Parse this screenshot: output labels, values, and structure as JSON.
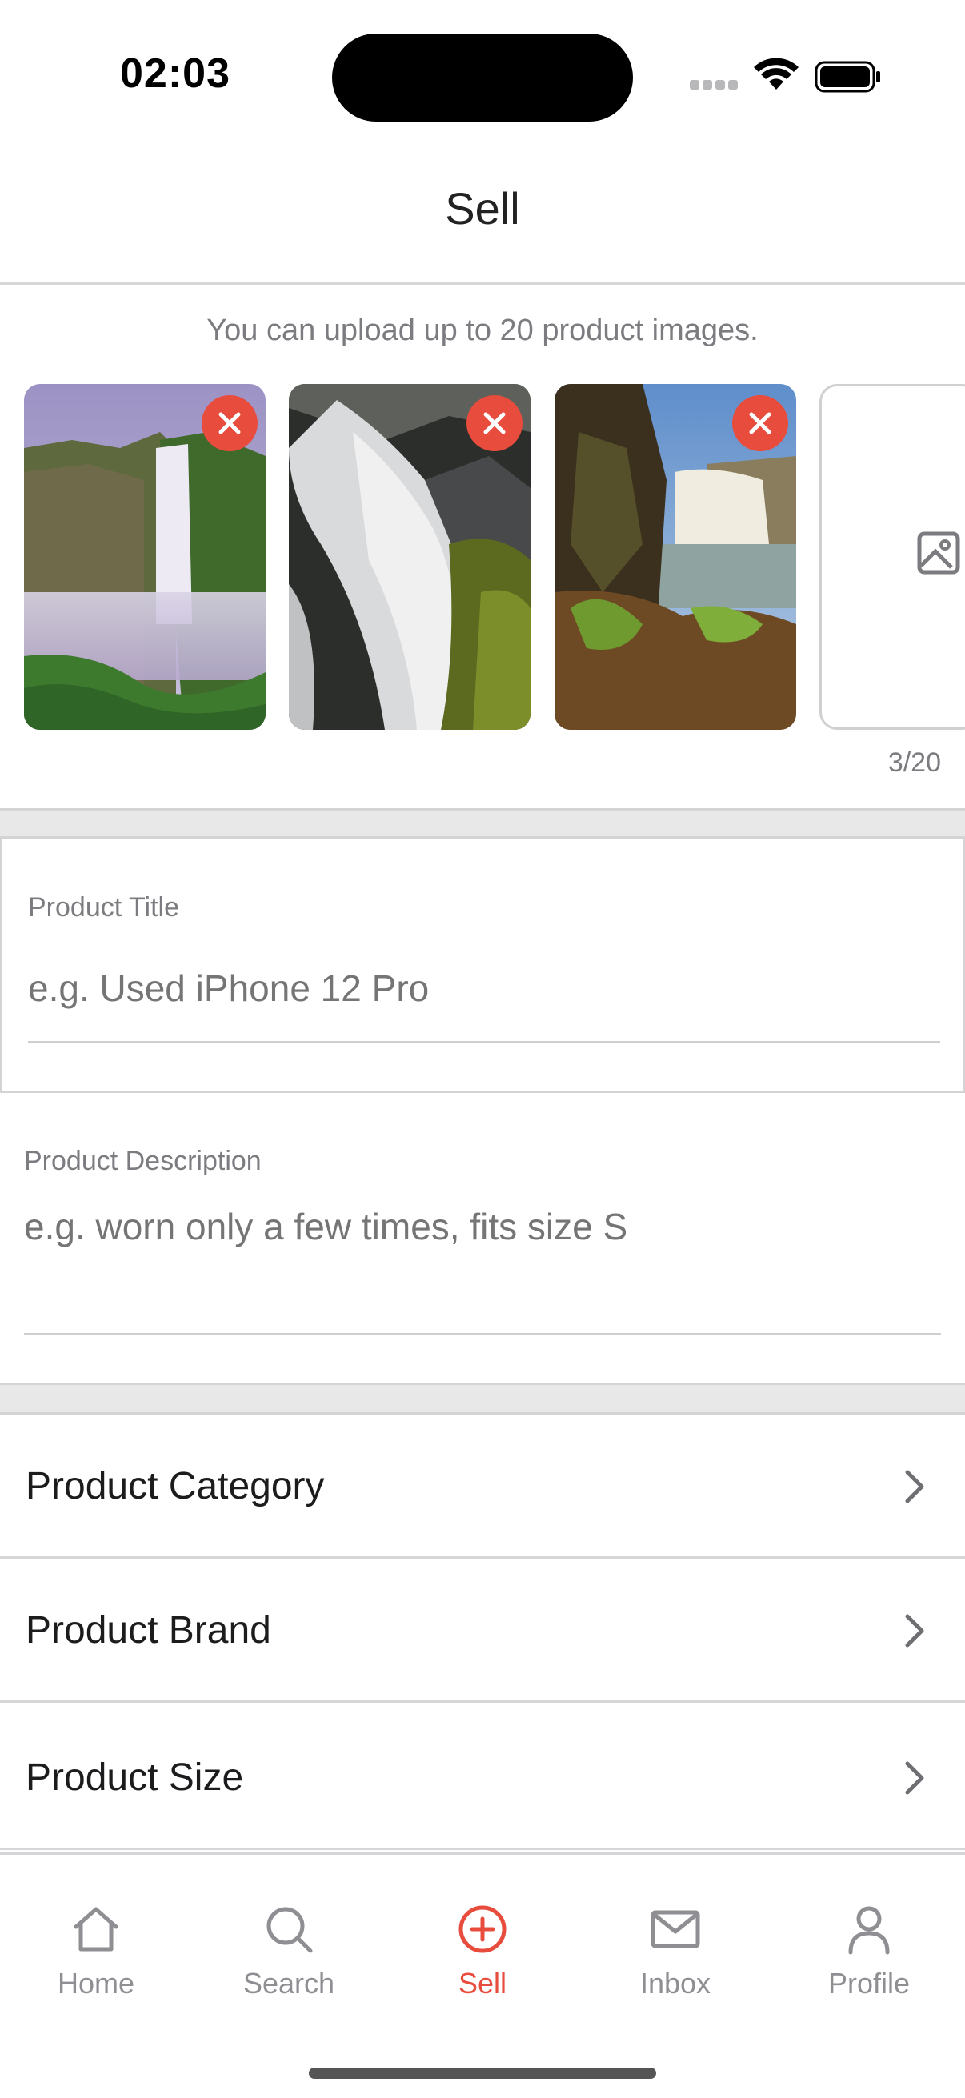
{
  "status_bar": {
    "time": "02:03"
  },
  "nav": {
    "title": "Sell"
  },
  "upload": {
    "hint": "You can upload up to 20 product images.",
    "count": "3/20",
    "images": [
      "waterfall-photo-1",
      "waterfall-photo-2",
      "waterfall-photo-3"
    ]
  },
  "form": {
    "title_label": "Product Title",
    "title_placeholder": "e.g. Used iPhone 12 Pro",
    "description_label": "Product Description",
    "description_placeholder": "e.g. worn only a few times, fits size S"
  },
  "rows": [
    {
      "label": "Product Category"
    },
    {
      "label": "Product Brand"
    },
    {
      "label": "Product Size"
    }
  ],
  "tabbar": {
    "items": [
      {
        "label": "Home",
        "icon": "home-icon"
      },
      {
        "label": "Search",
        "icon": "search-icon"
      },
      {
        "label": "Sell",
        "icon": "plus-circle-icon",
        "active": true
      },
      {
        "label": "Inbox",
        "icon": "mail-icon"
      },
      {
        "label": "Profile",
        "icon": "user-icon"
      }
    ]
  },
  "colors": {
    "accent": "#e74c3c",
    "secondary_text": "#7b7b80",
    "divider": "#d6d6d8"
  }
}
